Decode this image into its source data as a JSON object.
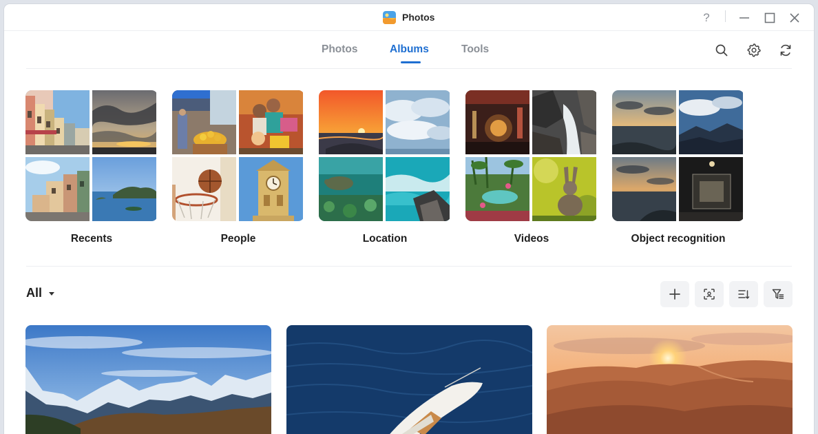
{
  "window": {
    "title": "Photos",
    "controls": [
      "help-icon",
      "minimize-icon",
      "maximize-icon",
      "close-icon"
    ],
    "help_label": "?"
  },
  "nav": {
    "tabs": [
      {
        "label": "Photos",
        "active": false
      },
      {
        "label": "Albums",
        "active": true
      },
      {
        "label": "Tools",
        "active": false
      }
    ],
    "actions": [
      "search-icon",
      "gear-icon",
      "refresh-icon"
    ]
  },
  "albums": [
    {
      "label": "Recents",
      "thumbs": [
        "street-houses",
        "cloudy-sunset",
        "street-houses-2",
        "sea-islands"
      ]
    },
    {
      "label": "People",
      "thumbs": [
        "market-stall",
        "fruit-vendors",
        "basketball-hoop",
        "clock-tower"
      ]
    },
    {
      "label": "Location",
      "thumbs": [
        "ocean-sunset",
        "cloudy-sky",
        "sea-turtle",
        "ocean-waves"
      ]
    },
    {
      "label": "Videos",
      "thumbs": [
        "restaurant",
        "waterfall-rocks",
        "garden-pool",
        "rabbit"
      ]
    },
    {
      "label": "Object recognition",
      "thumbs": [
        "sea-clouds",
        "mountain-sky",
        "sea-clouds-2",
        "museum-display"
      ]
    }
  ],
  "filter": {
    "label": "All",
    "tools": [
      "add-icon",
      "face-scan-icon",
      "sort-icon",
      "filter-icon"
    ]
  },
  "cards": [
    "mountains",
    "sailboat",
    "desert-dunes"
  ],
  "colors": {
    "accent": "#1f6fd1",
    "tab_inactive": "#8a8f96",
    "tool_button_bg": "#f2f3f5",
    "divider": "#eceef1"
  }
}
